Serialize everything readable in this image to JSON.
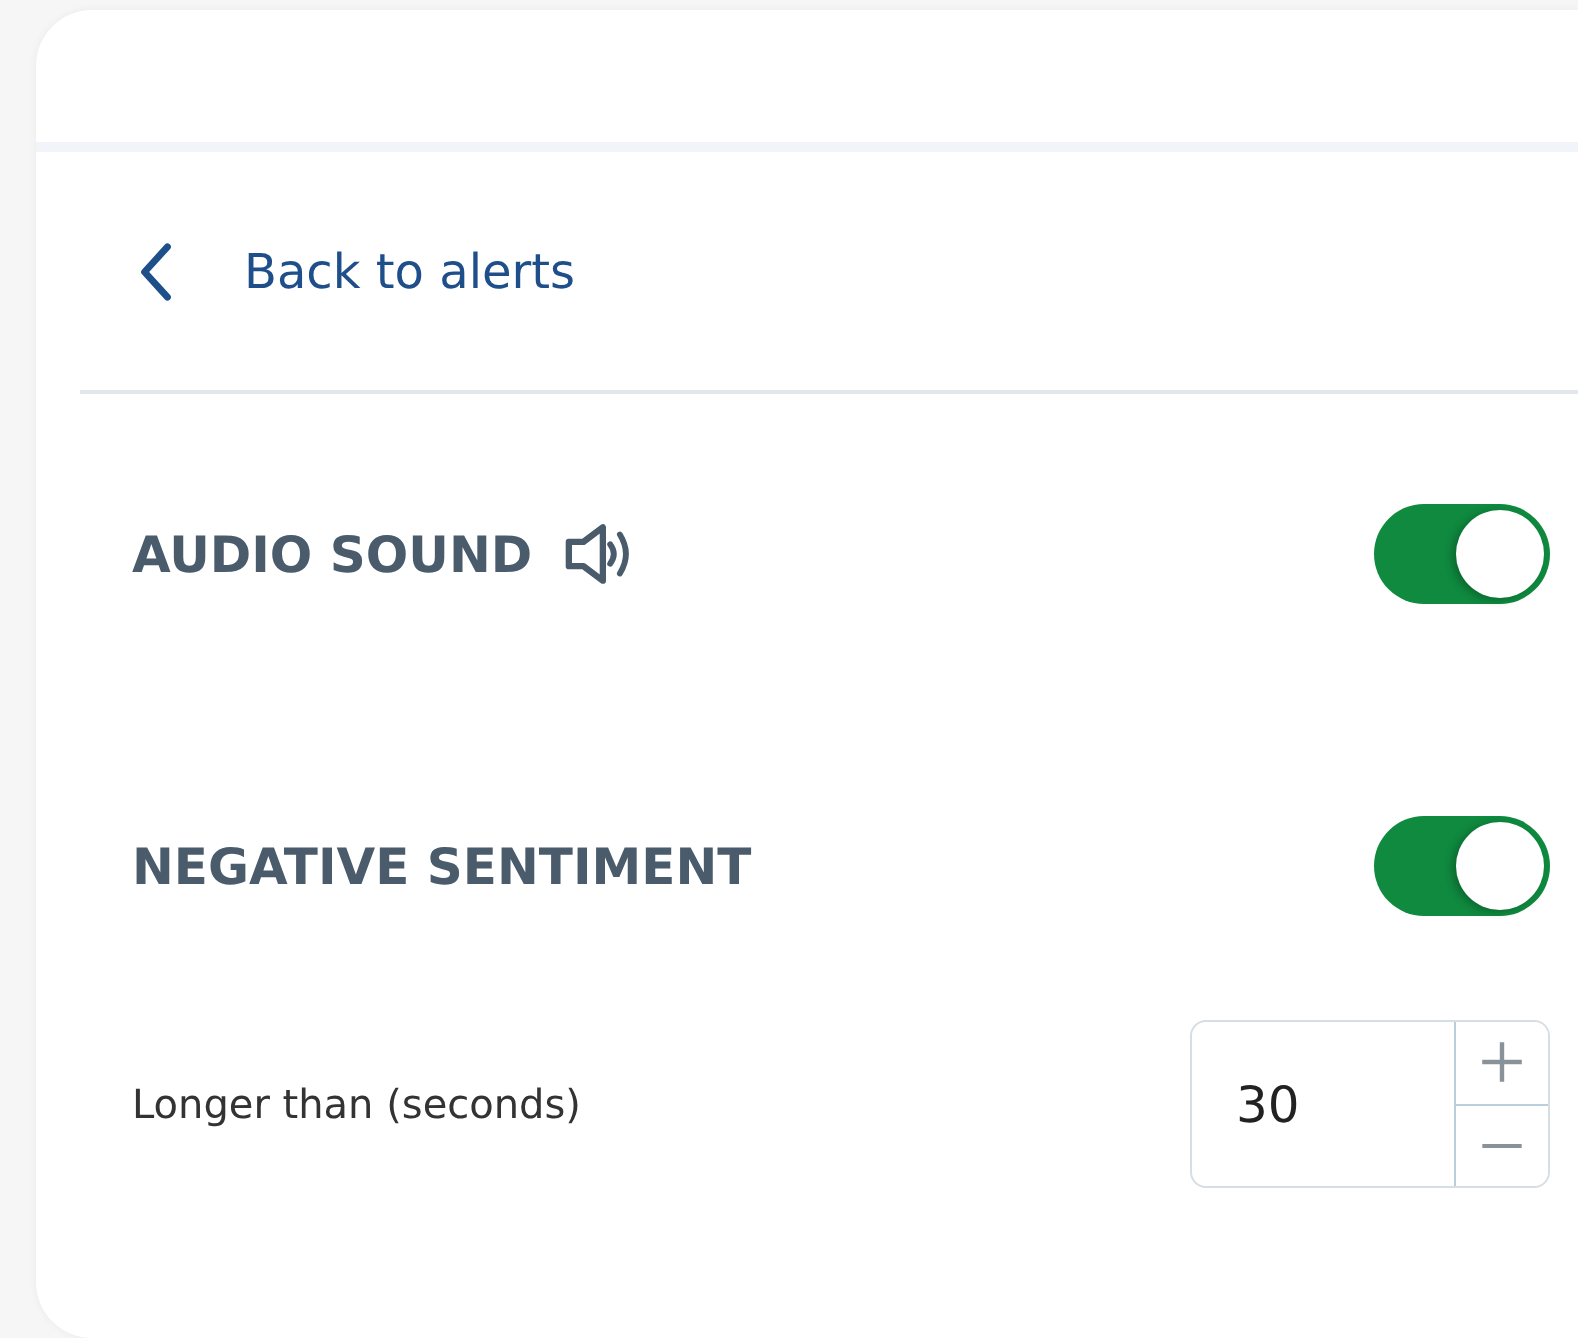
{
  "back_link": {
    "label": "Back to alerts"
  },
  "alerts": [
    {
      "title": "AUDIO SOUND",
      "kind": "sound",
      "on": true
    },
    {
      "title": "NEGATIVE SENTIMENT",
      "kind": "plain",
      "on": true
    }
  ],
  "duration": {
    "label": "Longer than (seconds)",
    "value": "30"
  }
}
